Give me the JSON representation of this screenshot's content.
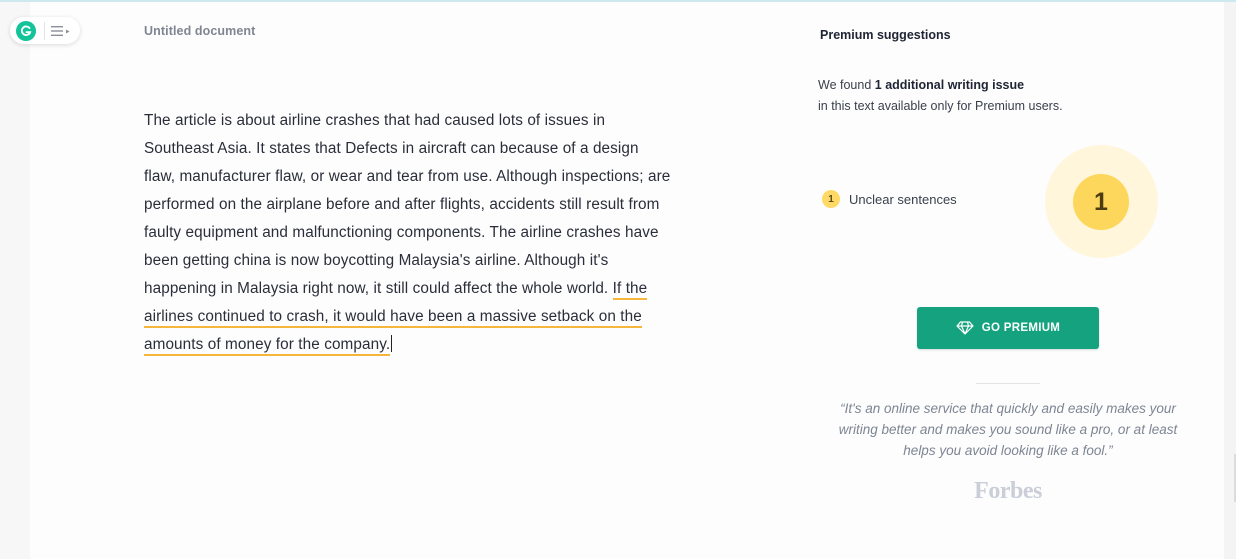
{
  "app": {
    "logo": "grammarly-g-icon",
    "menu_icon": "hamburger-menu-icon"
  },
  "document": {
    "title": "Untitled document",
    "body_plain": "The article is about airline crashes that had caused lots of issues in Southeast Asia.  It states that Defects in aircraft can because of a design flaw, manufacturer flaw, or wear and tear from use. Although inspections; are performed on the airplane before and after flights, accidents still result from faulty equipment and malfunctioning components. The airline crashes have been getting china is now boycotting Malaysia's airline. Although it's happening in Malaysia right now, it still could affect the whole world. ",
    "body_flagged": "If the airlines continued to crash, it would have been a massive setback on the amounts of money for the company."
  },
  "panel": {
    "title": "Premium suggestions",
    "found_prefix": "We found ",
    "found_bold": "1 additional writing issue",
    "found_sub": "in this text available only for Premium users.",
    "issues": [
      {
        "count": "1",
        "label": "Unclear sentences"
      }
    ],
    "total_count": "1",
    "premium_button": "GO PREMIUM",
    "premium_icon": "diamond-icon",
    "quote": "“It's an online service that quickly and easily makes your writing better and makes you sound like a pro, or at least helps you avoid looking like a fool.”",
    "quote_source": "Forbes"
  },
  "colors": {
    "accent_green": "#15a37f",
    "logo_green": "#15c39a",
    "underline_yellow": "#f5b73b",
    "badge_yellow": "#fdd65c"
  }
}
